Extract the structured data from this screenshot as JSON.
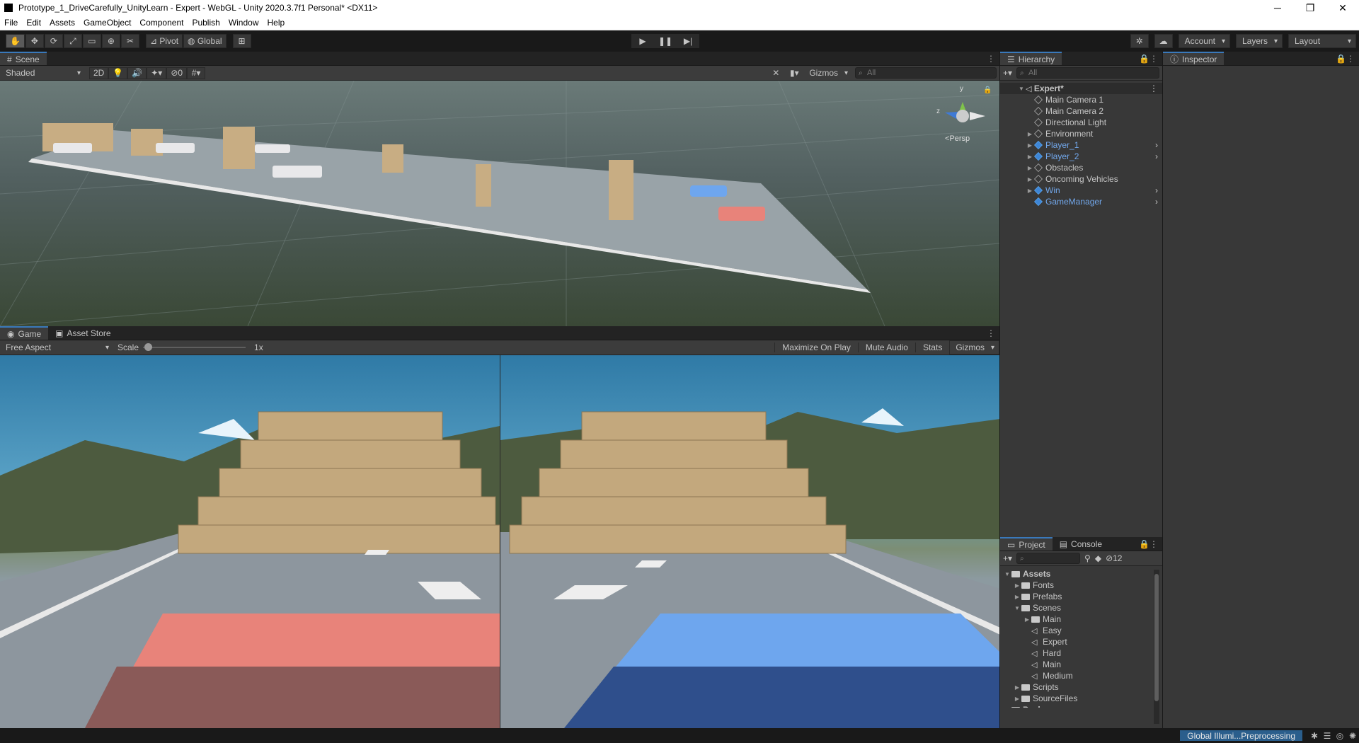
{
  "window": {
    "title": "Prototype_1_DriveCarefully_UnityLearn - Expert - WebGL - Unity 2020.3.7f1 Personal* <DX11>"
  },
  "menu": [
    "File",
    "Edit",
    "Assets",
    "GameObject",
    "Component",
    "Publish",
    "Window",
    "Help"
  ],
  "toolbar": {
    "pivot": "Pivot",
    "global": "Global",
    "account": "Account",
    "layers": "Layers",
    "layout": "Layout"
  },
  "scene": {
    "tab": "Scene",
    "shading": "Shaded",
    "mode2d": "2D",
    "hidden_count": "0",
    "gizmos": "Gizmos",
    "search": "All",
    "persp": "Persp",
    "axis_y": "y",
    "axis_z": "z"
  },
  "game": {
    "tab": "Game",
    "tab2": "Asset Store",
    "aspect": "Free Aspect",
    "scale_label": "Scale",
    "scale_value": "1x",
    "maximize": "Maximize On Play",
    "mute": "Mute Audio",
    "stats": "Stats",
    "gizmos": "Gizmos"
  },
  "hierarchy": {
    "tab": "Hierarchy",
    "search": "All",
    "root": "Expert*",
    "items": [
      {
        "label": "Main Camera 1",
        "prefab": false,
        "expandable": false
      },
      {
        "label": "Main Camera 2",
        "prefab": false,
        "expandable": false
      },
      {
        "label": "Directional Light",
        "prefab": false,
        "expandable": false
      },
      {
        "label": "Environment",
        "prefab": false,
        "expandable": true
      },
      {
        "label": "Player_1",
        "prefab": true,
        "expandable": true
      },
      {
        "label": "Player_2",
        "prefab": true,
        "expandable": true
      },
      {
        "label": "Obstacles",
        "prefab": false,
        "expandable": true
      },
      {
        "label": "Oncoming Vehicles",
        "prefab": false,
        "expandable": true
      },
      {
        "label": "Win",
        "prefab": true,
        "expandable": true
      },
      {
        "label": "GameManager",
        "prefab": true,
        "expandable": false
      }
    ]
  },
  "inspector": {
    "tab": "Inspector"
  },
  "project": {
    "tab": "Project",
    "tab2": "Console",
    "hidden_count": "12",
    "tree": [
      {
        "label": "Assets",
        "depth": 0,
        "type": "folder-open",
        "bold": true
      },
      {
        "label": "Fonts",
        "depth": 1,
        "type": "folder"
      },
      {
        "label": "Prefabs",
        "depth": 1,
        "type": "folder"
      },
      {
        "label": "Scenes",
        "depth": 1,
        "type": "folder-open"
      },
      {
        "label": "Main",
        "depth": 2,
        "type": "folder"
      },
      {
        "label": "Easy",
        "depth": 2,
        "type": "scene"
      },
      {
        "label": "Expert",
        "depth": 2,
        "type": "scene"
      },
      {
        "label": "Hard",
        "depth": 2,
        "type": "scene"
      },
      {
        "label": "Main",
        "depth": 2,
        "type": "scene"
      },
      {
        "label": "Medium",
        "depth": 2,
        "type": "scene"
      },
      {
        "label": "Scripts",
        "depth": 1,
        "type": "folder"
      },
      {
        "label": "SourceFiles",
        "depth": 1,
        "type": "folder"
      },
      {
        "label": "Packages",
        "depth": 0,
        "type": "folder",
        "bold": true
      }
    ]
  },
  "status": {
    "progress_text": "Global Illumi...Preprocessing"
  },
  "colors": {
    "accent": "#3a79bb",
    "prefab": "#72a8ec",
    "player1_car": "#e8837a",
    "player2_car": "#6ea6ee"
  }
}
